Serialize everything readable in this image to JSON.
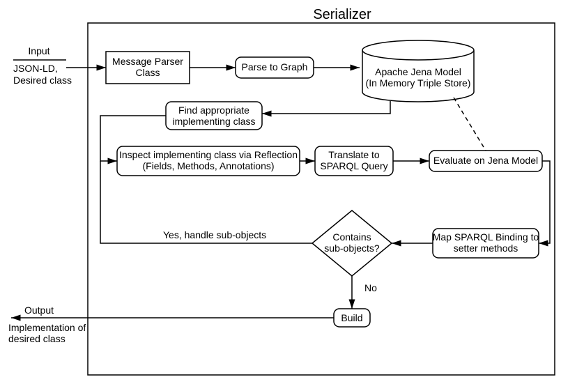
{
  "title": "Serializer",
  "input": {
    "label": "Input",
    "sub1": "JSON-LD,",
    "sub2": "Desired class"
  },
  "output": {
    "label": "Output",
    "sub1": "Implementation of",
    "sub2": "desired class"
  },
  "nodes": {
    "parser": "Message Parser\nClass",
    "parse_graph": "Parse to Graph",
    "jena": "Apache Jena Model\n(In Memory Triple Store)",
    "find_impl": "Find appropriate\nimplementing class",
    "inspect": "Inspect implementing class via Reflection\n(Fields, Methods, Annotations)",
    "translate": "Translate to\nSPARQL Query",
    "evaluate": "Evaluate on Jena Model",
    "map_binding": "Map SPARQL Binding to\nsetter methods",
    "decision": "Contains\nsub-objects?",
    "build": "Build"
  },
  "edges": {
    "yes": "Yes, handle sub-objects",
    "no": "No"
  }
}
